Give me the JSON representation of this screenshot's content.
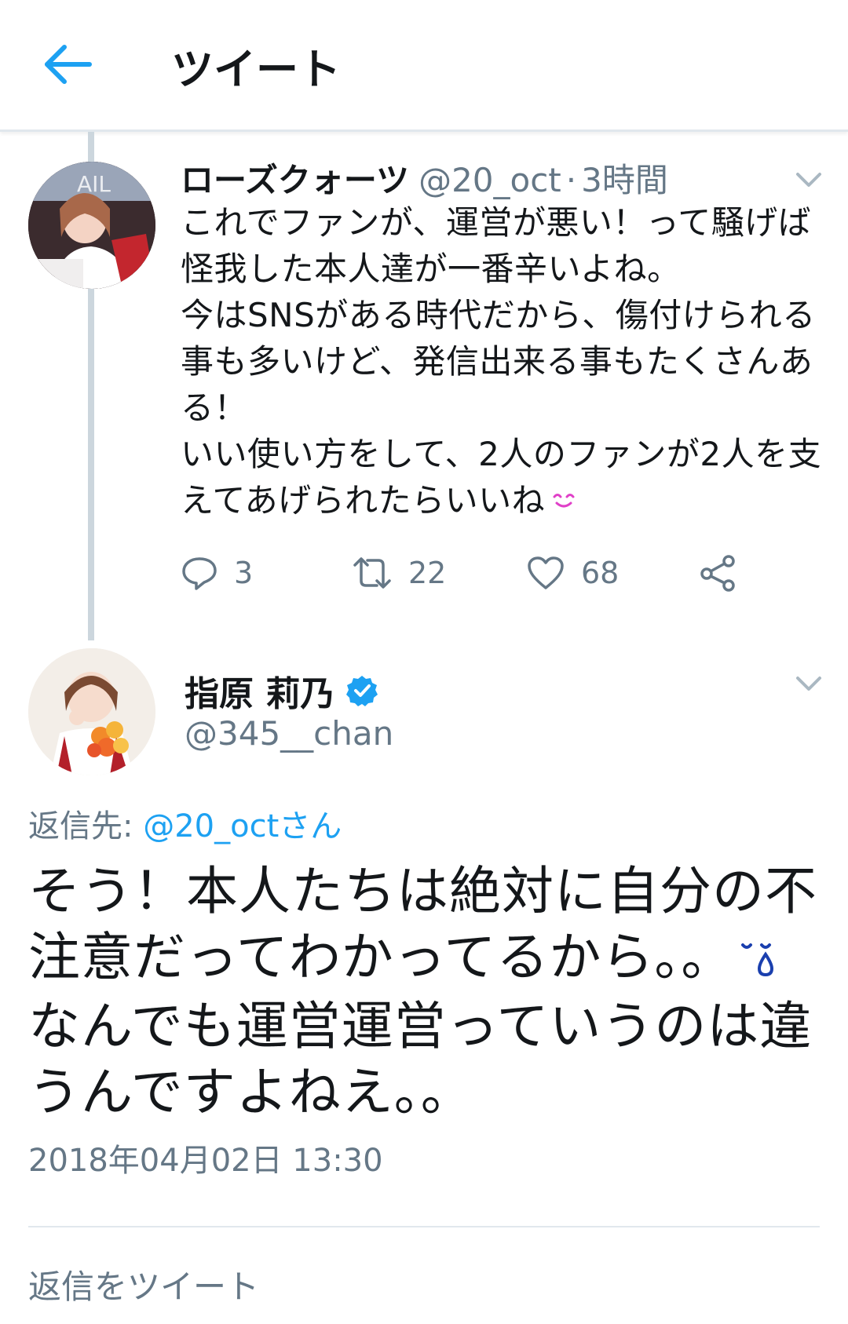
{
  "header": {
    "back_icon": "arrow-left-icon",
    "title": "ツイート",
    "accent": "#1da1f2"
  },
  "tweet1": {
    "avatar_icon": "user-avatar",
    "name": "ローズクォーツ",
    "handle": "@20_oct",
    "dot": "·",
    "time": "3時間",
    "body_lines": [
      "これでファンが、運営が悪い！って騒げば怪我した本人達が一番辛いよね。",
      "今はSNSがある時代だから、傷付けられる事も多いけど、発信出来る事もたくさんある！",
      "いい使い方をして、2人のファンが2人を支えてあげられたらいいね"
    ],
    "emoji": "smile-emoji",
    "actions": {
      "reply_count": "3",
      "retweet_count": "22",
      "like_count": "68"
    }
  },
  "tweet2": {
    "avatar_icon": "user-avatar",
    "name": "指原 莉乃",
    "verified_icon": "verified-badge-icon",
    "handle": "@345__chan",
    "reply_label": "返信先:",
    "reply_mention": "@20_octさん",
    "body_lines": [
      "そう！本人たちは絶対に自分の不注意だってわかってるから。。",
      "なんでも運営運営っていうのは違うんですよねえ。。"
    ],
    "emoji": "teardrop-emoji",
    "timestamp": "2018年04月02日 13:30"
  },
  "compose": {
    "placeholder": "返信をツイート"
  },
  "colors": {
    "text": "#14171a",
    "muted": "#657786",
    "link": "#1da1f2",
    "divider": "#e1e8ed",
    "verified": "#1da1f2"
  }
}
